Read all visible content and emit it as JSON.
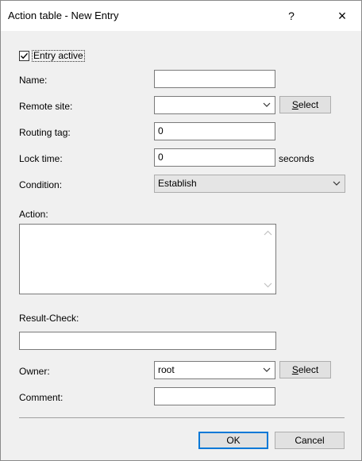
{
  "window": {
    "title": "Action table - New Entry",
    "help_label": "?",
    "close_label": "×"
  },
  "form": {
    "entry_active": {
      "label": "Entry active",
      "checked": true
    },
    "name": {
      "label": "Name:",
      "value": ""
    },
    "remote_site": {
      "label": "Remote site:",
      "value": "",
      "select_label_mnemonic": "S",
      "select_label_rest": "elect"
    },
    "routing_tag": {
      "label": "Routing tag:",
      "value": "0"
    },
    "lock_time": {
      "label": "Lock time:",
      "value": "0",
      "unit": "seconds"
    },
    "condition": {
      "label": "Condition:",
      "value": "Establish"
    },
    "action": {
      "label": "Action:",
      "value": ""
    },
    "result_check": {
      "label": "Result-Check:",
      "value": ""
    },
    "owner": {
      "label": "Owner:",
      "value": "root",
      "select_label_mnemonic": "S",
      "select_label_rest": "elect"
    },
    "comment": {
      "label": "Comment:",
      "value": ""
    }
  },
  "buttons": {
    "ok": "OK",
    "cancel": "Cancel"
  },
  "colors": {
    "dialog_bg": "#f0f0f0",
    "accent": "#0078d7"
  }
}
